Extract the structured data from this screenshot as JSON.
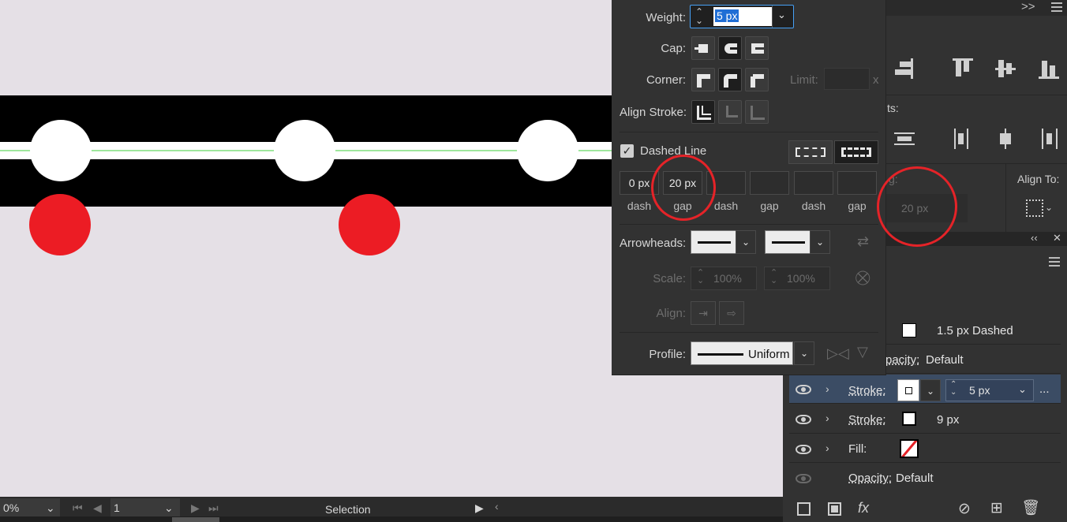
{
  "stroke_panel": {
    "weight_label": "Weight:",
    "weight_value": "5 px",
    "cap_label": "Cap:",
    "corner_label": "Corner:",
    "limit_label": "Limit:",
    "limit_suffix": "x",
    "align_stroke_label": "Align Stroke:",
    "dashed_line_label": "Dashed Line",
    "dashed_line_checked": true,
    "dash_fields": [
      {
        "value": "0 px",
        "caption": "dash"
      },
      {
        "value": "20 px",
        "caption": "gap"
      },
      {
        "value": "",
        "caption": "dash"
      },
      {
        "value": "",
        "caption": "gap"
      },
      {
        "value": "",
        "caption": "dash"
      },
      {
        "value": "",
        "caption": "gap"
      }
    ],
    "arrowheads_label": "Arrowheads:",
    "scale_label": "Scale:",
    "scale_start": "100%",
    "scale_end": "100%",
    "align_label": "Align:",
    "profile_label": "Profile:",
    "profile_value": "Uniform"
  },
  "align_panel": {
    "partial_label_1": "ts:",
    "partial_label_2": "g:",
    "spacing_value": "20 px",
    "align_to_label": "Align To:"
  },
  "appearance": {
    "header_value": "1.5 px Dashed",
    "opacity_partial_label": "pacity:",
    "opacity_partial_value": "Default",
    "rows": [
      {
        "label": "Stroke:",
        "value": "5 px",
        "swatch": "#ffffff",
        "selected": true
      },
      {
        "label": "Stroke:",
        "value": "9 px",
        "swatch": "#000000",
        "selected": false
      },
      {
        "label": "Fill:",
        "value": "",
        "swatch": "none",
        "selected": false
      },
      {
        "label": "Opacity:",
        "value": "Default",
        "swatch": "",
        "selected": false
      }
    ],
    "more_label": "..."
  },
  "statusbar": {
    "zoom": "0%",
    "artboard_number": "1",
    "tool": "Selection"
  },
  "colors": {
    "accent_blue": "#46a0f5",
    "annotation_red": "#e52328",
    "artwork_red": "#ec1c24",
    "guide_green": "#9fe79d"
  }
}
